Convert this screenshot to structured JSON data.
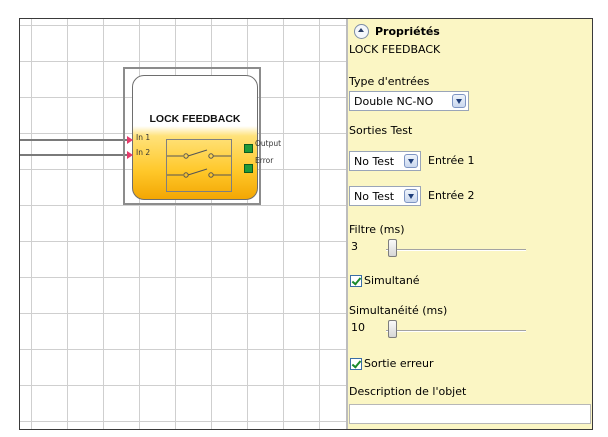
{
  "block": {
    "title": "LOCK FEEDBACK",
    "inputs": [
      "In 1",
      "In 2"
    ],
    "outputs": [
      "Output",
      "Error"
    ]
  },
  "panel": {
    "header": "Propriétés",
    "object_name": "LOCK FEEDBACK",
    "input_type_label": "Type d'entrées",
    "input_type_value": "Double NC-NO",
    "test_outputs_label": "Sorties Test",
    "test1_value": "No Test",
    "test1_label": "Entrée 1",
    "test2_value": "No Test",
    "test2_label": "Entrée 2",
    "filter_label": "Filtre (ms)",
    "filter_value": "3",
    "simultaneous_label": "Simultané",
    "simultaneous_checked": true,
    "simultaneity_label": "Simultanéité (ms)",
    "simultaneity_value": "10",
    "error_output_label": "Sortie erreur",
    "error_output_checked": true,
    "description_label": "Description de l'objet",
    "description_value": ""
  },
  "colors": {
    "panel_bg": "#fbf6c4",
    "block_gradient_end": "#f2a400",
    "pin_in": "#e53a6a",
    "pin_out": "#1e9a3a"
  }
}
